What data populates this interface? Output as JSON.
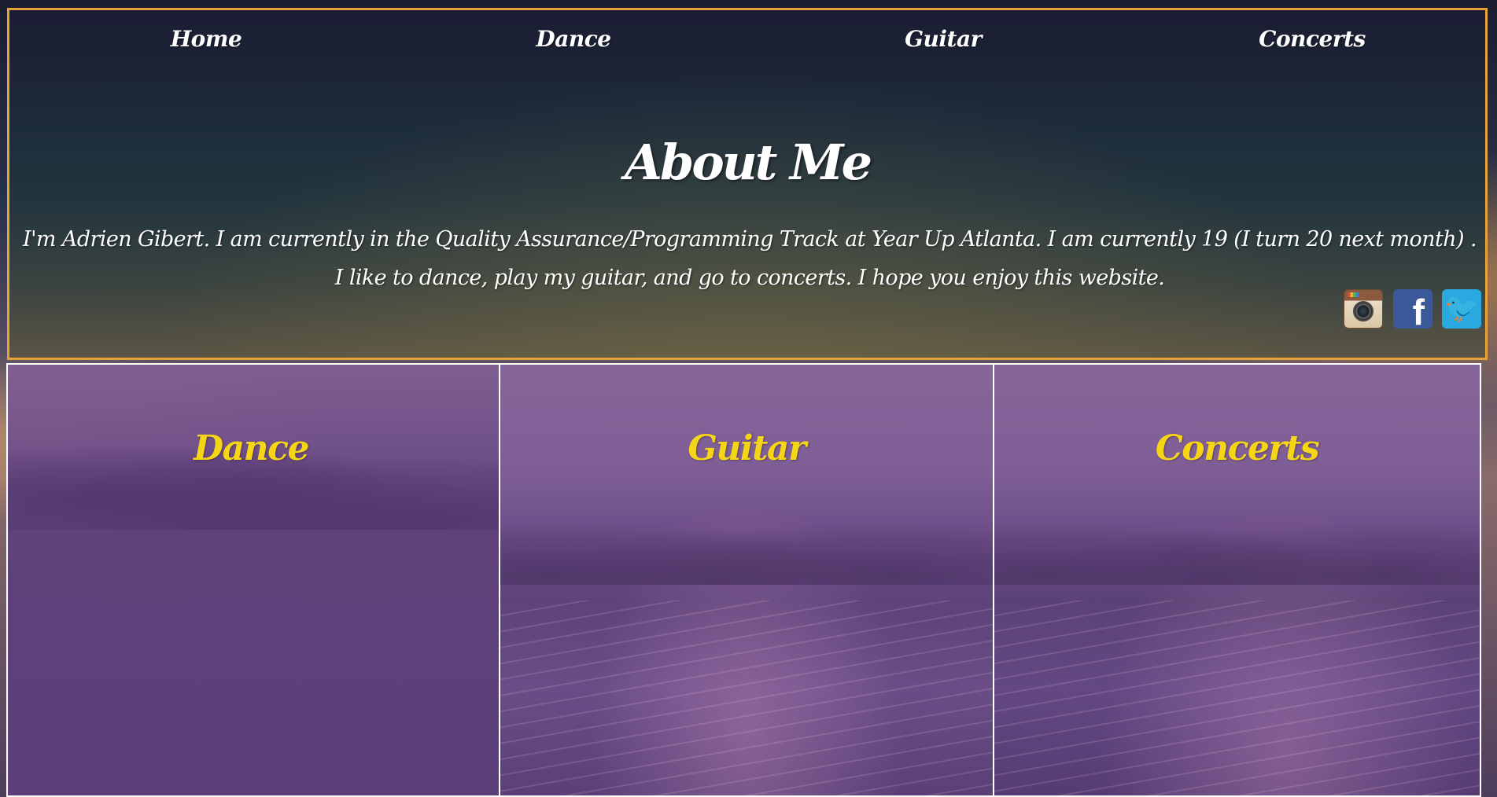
{
  "nav": {
    "items": [
      {
        "label": "Home"
      },
      {
        "label": "Dance"
      },
      {
        "label": "Guitar"
      },
      {
        "label": "Concerts"
      }
    ]
  },
  "about": {
    "title": "About Me",
    "text": "I'm Adrien Gibert. I am currently in the Quality Assurance/Programming Track at Year Up Atlanta. I am currently 19  (I turn 20 next month) . I like to dance, play my guitar, and go to concerts. I hope you enjoy this website."
  },
  "social": {
    "icons": [
      {
        "icon": "instagram-icon"
      },
      {
        "icon": "facebook-icon",
        "glyph": "f"
      },
      {
        "icon": "twitter-icon",
        "glyph": "🐦"
      }
    ]
  },
  "panels": [
    {
      "title": "Dance"
    },
    {
      "title": "Guitar"
    },
    {
      "title": "Concerts"
    }
  ],
  "colors": {
    "header_border": "#e8a23a",
    "panel_title": "#f5d617",
    "panel_border": "#ffffff"
  }
}
